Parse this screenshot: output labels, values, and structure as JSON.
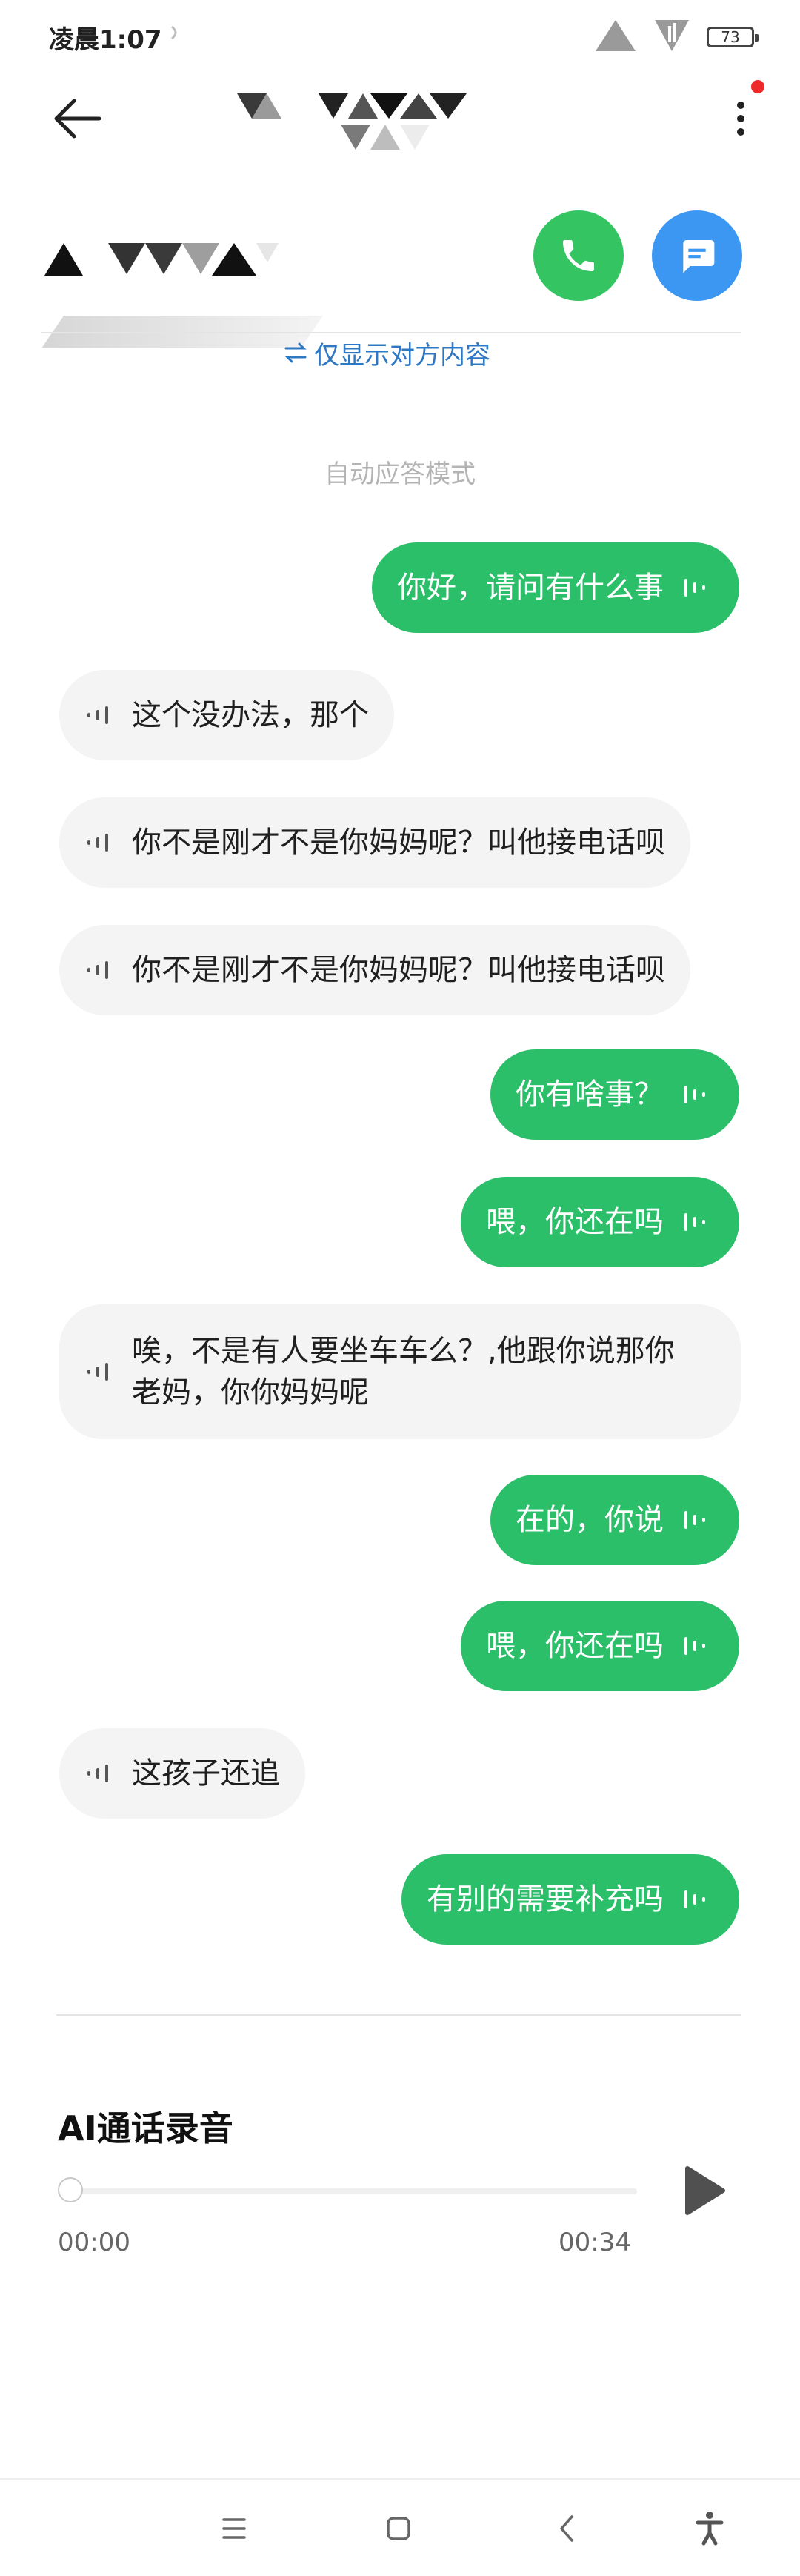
{
  "status": {
    "time": "凌晨1:07",
    "battery": "73"
  },
  "header": {
    "title_redacted": true
  },
  "contact": {
    "name_redacted": true,
    "filter_label": "仅显示对方内容"
  },
  "chat": {
    "mode_label": "自动应答模式",
    "messages": [
      {
        "side": "right",
        "text": "你好，请问有什么事"
      },
      {
        "side": "left",
        "text": "这个没办法，那个"
      },
      {
        "side": "left",
        "text": "你不是刚才不是你妈妈呢？叫他接电话呗"
      },
      {
        "side": "left",
        "text": "你不是刚才不是你妈妈呢？叫他接电话呗"
      },
      {
        "side": "right",
        "text": "你有啥事？"
      },
      {
        "side": "right",
        "text": "喂，你还在吗"
      },
      {
        "side": "left",
        "text": "唉，不是有人要坐车车么？,他跟你说那你\n老妈，你你妈妈呢"
      },
      {
        "side": "right",
        "text": "在的，你说"
      },
      {
        "side": "right",
        "text": "喂，你还在吗"
      },
      {
        "side": "left",
        "text": "这孩子还追"
      },
      {
        "side": "right",
        "text": "有别的需要补充吗"
      }
    ]
  },
  "recording": {
    "title": "AI通话录音",
    "current_time": "00:00",
    "total_time": "00:34",
    "progress": 0
  },
  "colors": {
    "accent_green": "#2bbf6a",
    "call_green": "#34c462",
    "message_blue": "#3c97f3",
    "link_blue": "#2d78c4"
  },
  "icons": {
    "back": "arrow-left-icon",
    "menu": "more-vertical-icon",
    "call": "phone-icon",
    "message": "chat-bubble-icon",
    "play": "play-icon",
    "nav": [
      "menu-icon",
      "home-icon",
      "back-icon",
      "accessibility-icon"
    ]
  }
}
